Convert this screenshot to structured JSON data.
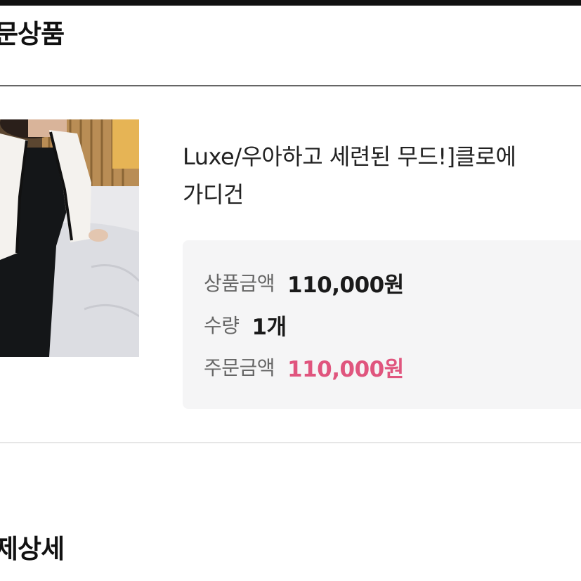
{
  "colors": {
    "accent": "#e0557e",
    "label": "#666666",
    "value": "#1a1a1a",
    "box_bg": "#f5f5f6"
  },
  "sections": {
    "order_title": "문상품",
    "payment_title": "제상세"
  },
  "product": {
    "image_icon": "product-thumbnail",
    "name_line1": "Luxe/우아하고 세련된 무드!]클로에",
    "name_line2": "가디건"
  },
  "price": {
    "product_amount_label": "상품금액",
    "product_amount_value": "110,000원",
    "quantity_label": "수량",
    "quantity_value": "1개",
    "order_amount_label": "주문금액",
    "order_amount_value": "110,000원"
  }
}
